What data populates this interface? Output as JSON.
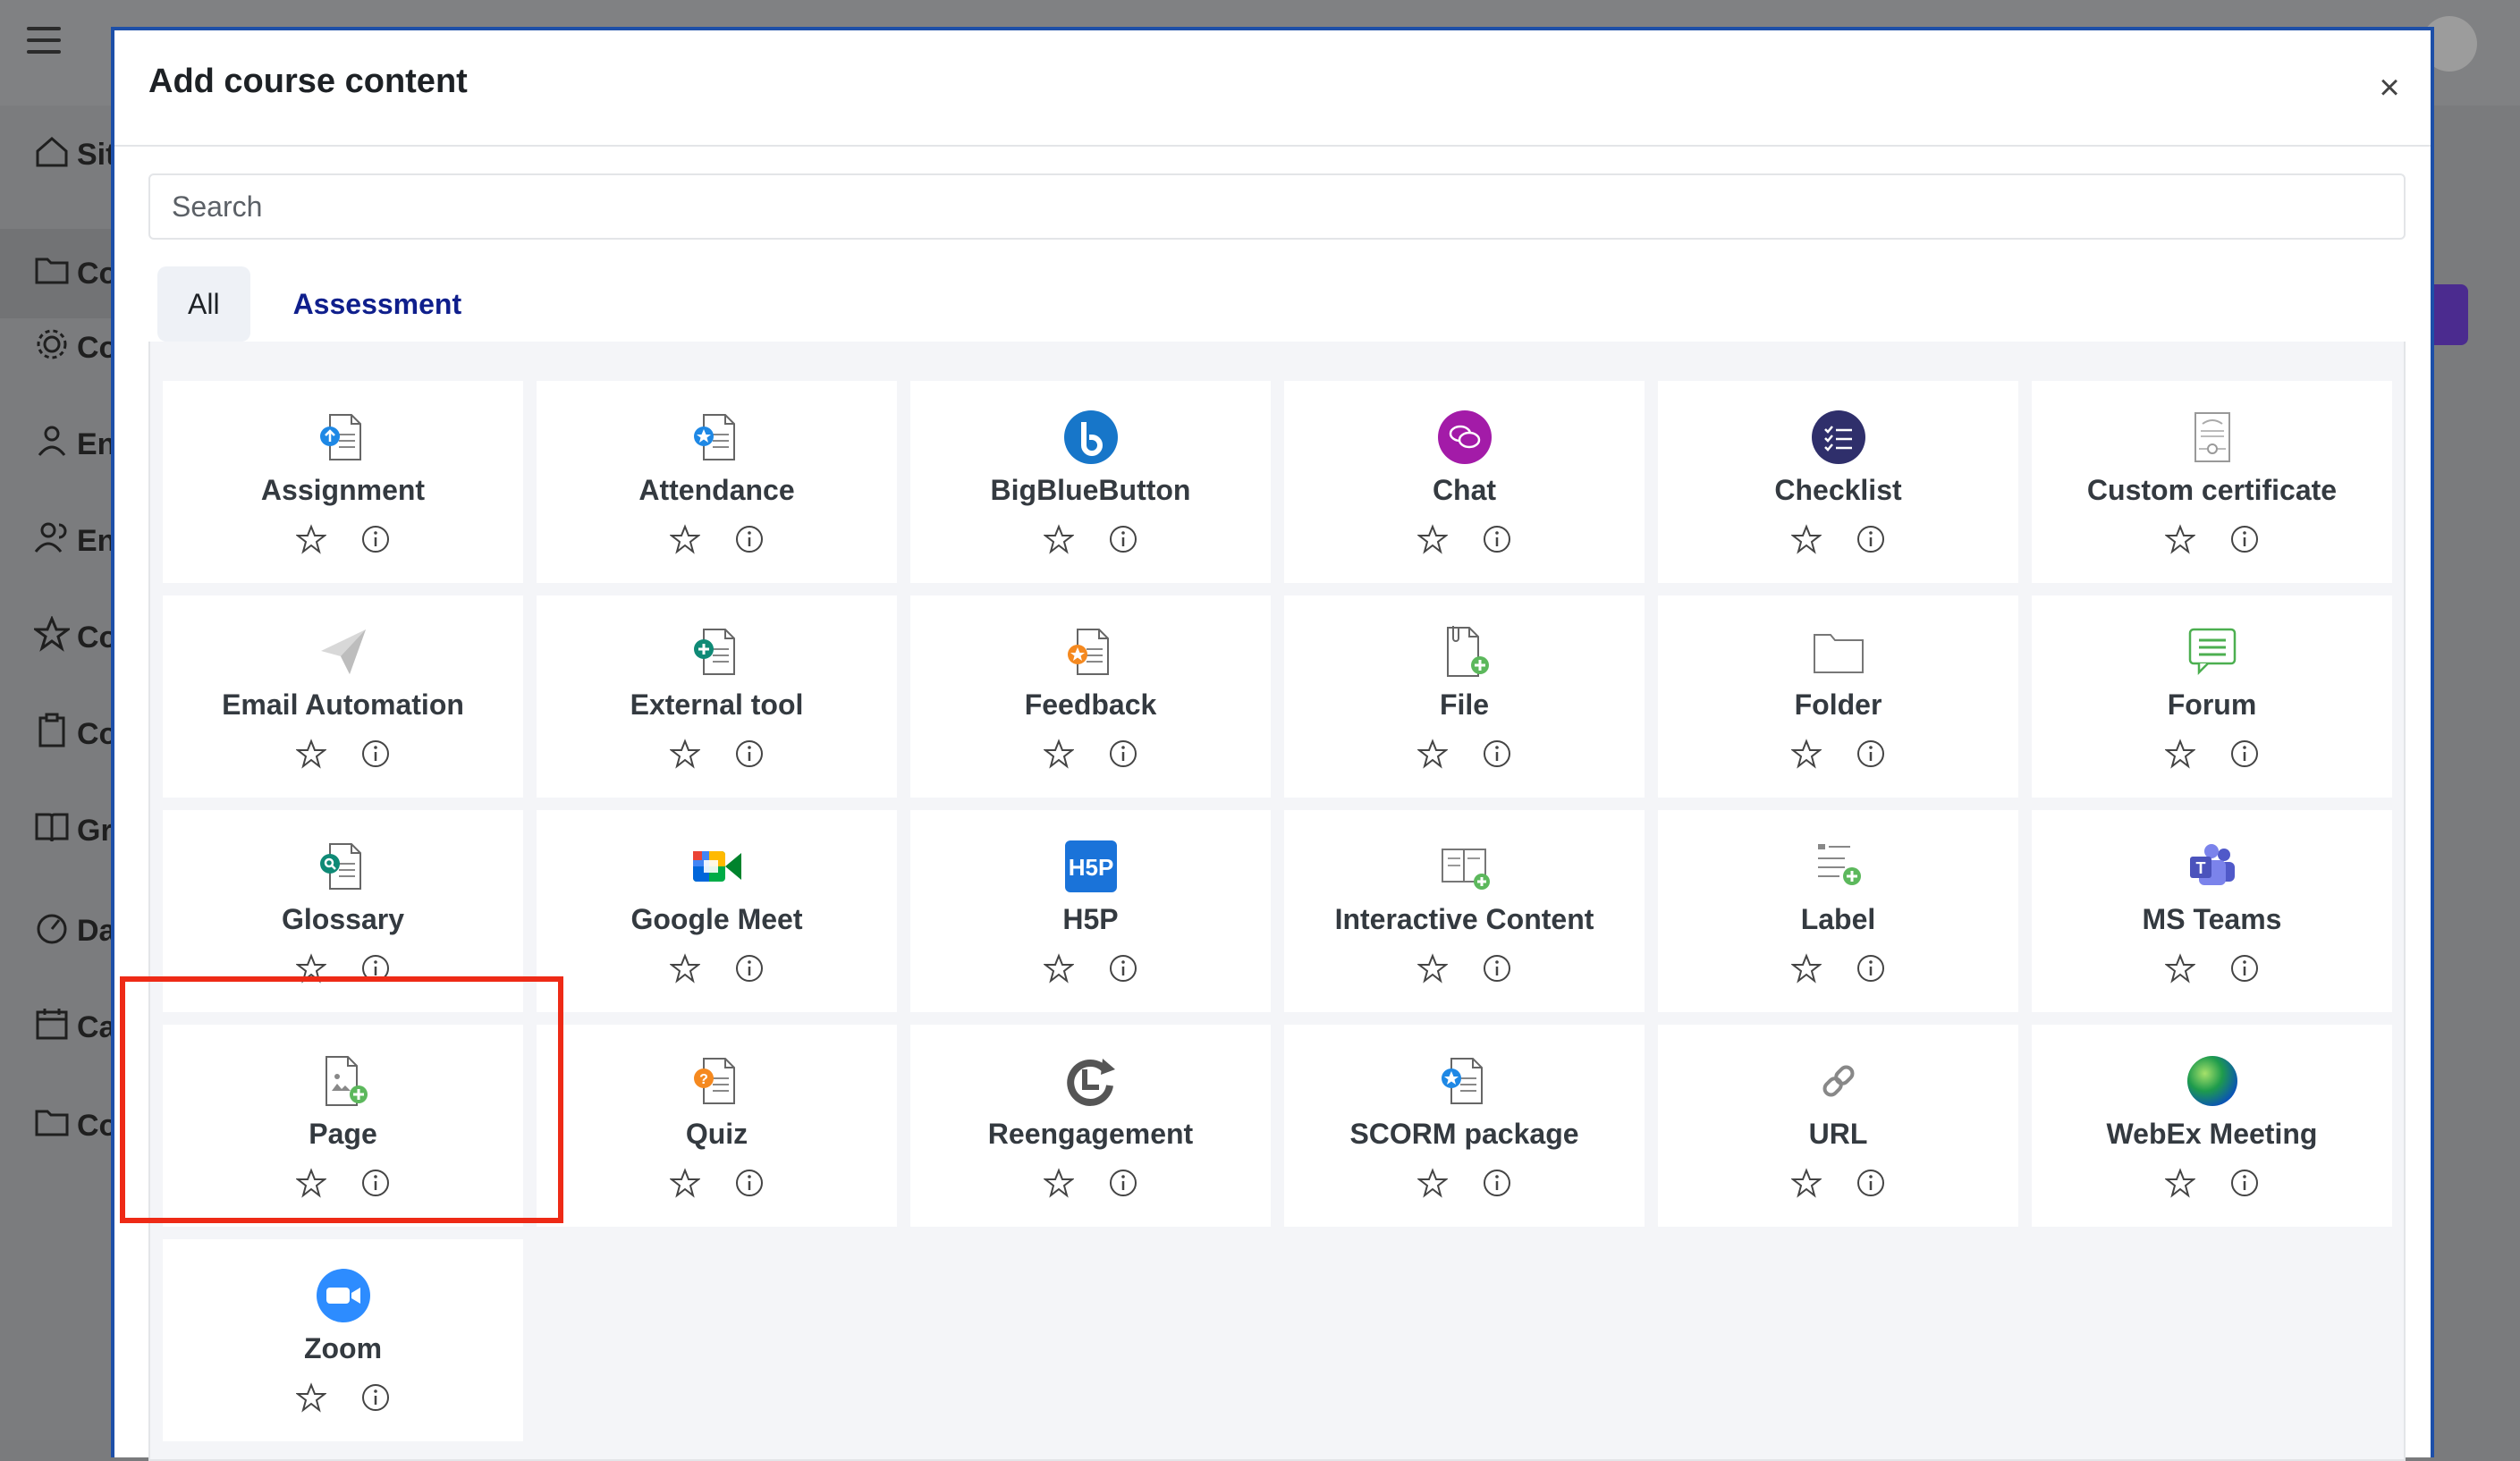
{
  "background": {
    "sidebar_items": [
      {
        "label": "Sit",
        "icon": "home-icon"
      },
      {
        "label": "Co",
        "icon": "folder-icon"
      },
      {
        "label": "Co",
        "icon": "gear-icon"
      },
      {
        "label": "En",
        "icon": "user-icon"
      },
      {
        "label": "En",
        "icon": "users-icon"
      },
      {
        "label": "Co",
        "icon": "star-icon"
      },
      {
        "label": "Co",
        "icon": "clipboard-icon"
      },
      {
        "label": "Gr",
        "icon": "book-icon"
      },
      {
        "label": "Da",
        "icon": "gauge-icon"
      },
      {
        "label": "Ca",
        "icon": "calendar-icon"
      },
      {
        "label": "Co",
        "icon": "folder-icon"
      }
    ]
  },
  "modal": {
    "title": "Add course content",
    "close_symbol": "×",
    "search_placeholder": "Search",
    "tabs": [
      {
        "label": "All",
        "active": true
      },
      {
        "label": "Assessment",
        "active": false
      }
    ],
    "activities": [
      {
        "label": "Assignment",
        "icon": "assignment-icon"
      },
      {
        "label": "Attendance",
        "icon": "attendance-icon"
      },
      {
        "label": "BigBlueButton",
        "icon": "bigbluebutton-icon"
      },
      {
        "label": "Chat",
        "icon": "chat-icon"
      },
      {
        "label": "Checklist",
        "icon": "checklist-icon"
      },
      {
        "label": "Custom certificate",
        "icon": "certificate-icon"
      },
      {
        "label": "Email Automation",
        "icon": "paper-plane-icon"
      },
      {
        "label": "External tool",
        "icon": "external-tool-icon"
      },
      {
        "label": "Feedback",
        "icon": "feedback-icon"
      },
      {
        "label": "File",
        "icon": "file-icon"
      },
      {
        "label": "Folder",
        "icon": "folder-icon"
      },
      {
        "label": "Forum",
        "icon": "forum-icon"
      },
      {
        "label": "Glossary",
        "icon": "glossary-icon"
      },
      {
        "label": "Google Meet",
        "icon": "google-meet-icon"
      },
      {
        "label": "H5P",
        "icon": "h5p-icon"
      },
      {
        "label": "Interactive Content",
        "icon": "interactive-content-icon"
      },
      {
        "label": "Label",
        "icon": "label-icon"
      },
      {
        "label": "MS Teams",
        "icon": "ms-teams-icon"
      },
      {
        "label": "Page",
        "icon": "page-icon"
      },
      {
        "label": "Quiz",
        "icon": "quiz-icon"
      },
      {
        "label": "Reengagement",
        "icon": "reengagement-icon"
      },
      {
        "label": "SCORM package",
        "icon": "scorm-icon"
      },
      {
        "label": "URL",
        "icon": "url-link-icon"
      },
      {
        "label": "WebEx Meeting",
        "icon": "webex-icon"
      },
      {
        "label": "Zoom",
        "icon": "zoom-icon"
      }
    ]
  },
  "colors": {
    "modal_border": "#1d4fa8",
    "tab_link": "#0f1f8c",
    "highlight": "#ee2a16"
  }
}
